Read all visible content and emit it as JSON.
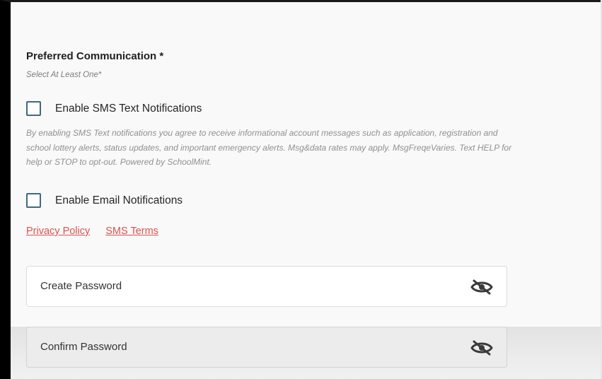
{
  "preferred": {
    "title": "Preferred Communication *",
    "subtitle": "Select At Least One*"
  },
  "sms": {
    "label": "Enable SMS Text Notifications",
    "checked": false,
    "disclaimer": "By enabling SMS Text notifications you agree to receive informational account messages such as application, registration and school lottery alerts, status updates, and important emergency alerts. Msg&data rates may apply. MsgFreqeVaries. Text HELP for help or STOP to opt-out. Powered by SchoolMint."
  },
  "email": {
    "label": "Enable Email Notifications",
    "checked": false
  },
  "links": {
    "privacy": "Privacy Policy",
    "sms_terms": "SMS Terms",
    "color": "#d9534f"
  },
  "password": {
    "create_label": "Create Password",
    "confirm_label": "Confirm Password",
    "toggle_icon": "eye-slash-icon"
  },
  "colors": {
    "checkbox_border": "#3f6b7c",
    "link": "#d9534f"
  }
}
